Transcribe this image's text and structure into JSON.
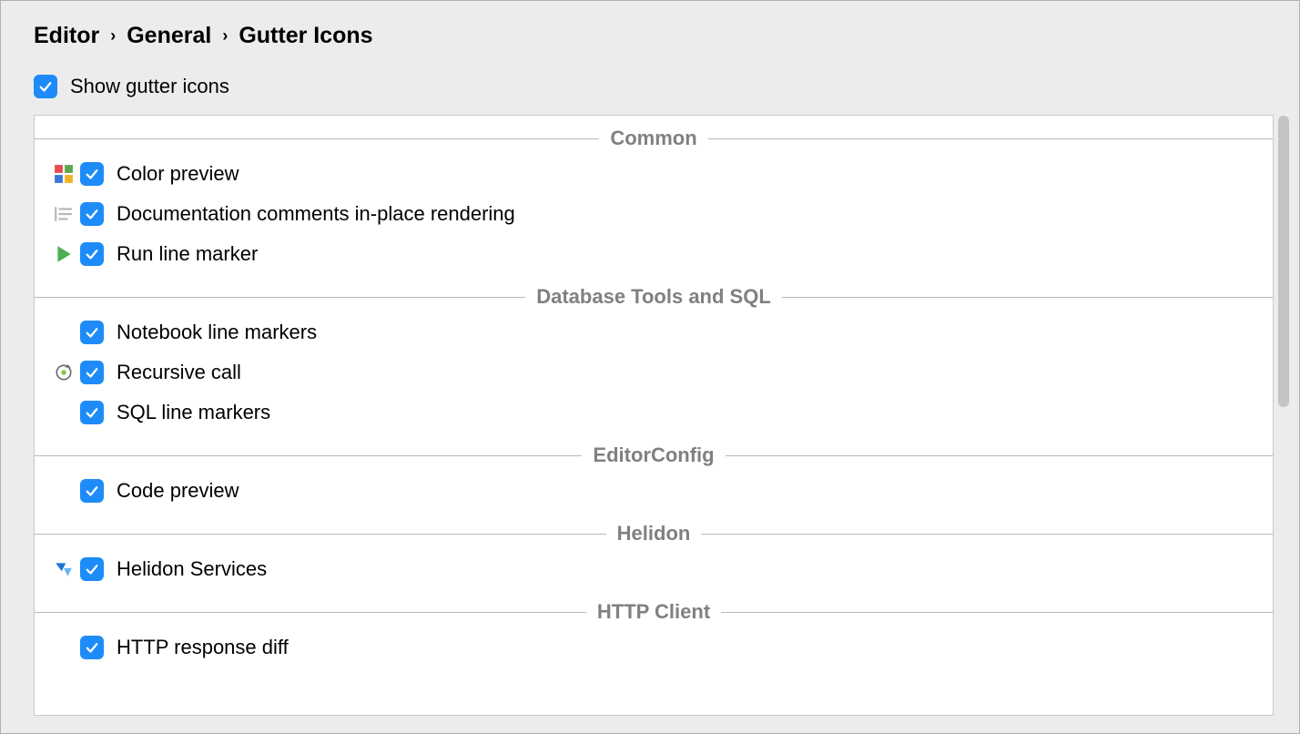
{
  "breadcrumb": {
    "item0": "Editor",
    "item1": "General",
    "item2": "Gutter Icons"
  },
  "topCheckbox": {
    "label": "Show gutter icons",
    "checked": true
  },
  "sections": {
    "common": {
      "title": "Common",
      "items": [
        {
          "label": "Color preview",
          "icon": "color-grid-icon",
          "checked": true
        },
        {
          "label": "Documentation comments in-place rendering",
          "icon": "doc-lines-icon",
          "checked": true
        },
        {
          "label": "Run line marker",
          "icon": "run-icon",
          "checked": true
        }
      ]
    },
    "database": {
      "title": "Database Tools and SQL",
      "items": [
        {
          "label": "Notebook line markers",
          "icon": null,
          "checked": true
        },
        {
          "label": "Recursive call",
          "icon": "recursive-icon",
          "checked": true
        },
        {
          "label": "SQL line markers",
          "icon": null,
          "checked": true
        }
      ]
    },
    "editorconfig": {
      "title": "EditorConfig",
      "items": [
        {
          "label": "Code preview",
          "icon": null,
          "checked": true
        }
      ]
    },
    "helidon": {
      "title": "Helidon",
      "items": [
        {
          "label": "Helidon Services",
          "icon": "helidon-icon",
          "checked": true
        }
      ]
    },
    "httpclient": {
      "title": "HTTP Client",
      "items": [
        {
          "label": "HTTP response diff",
          "icon": null,
          "checked": true
        }
      ]
    }
  }
}
